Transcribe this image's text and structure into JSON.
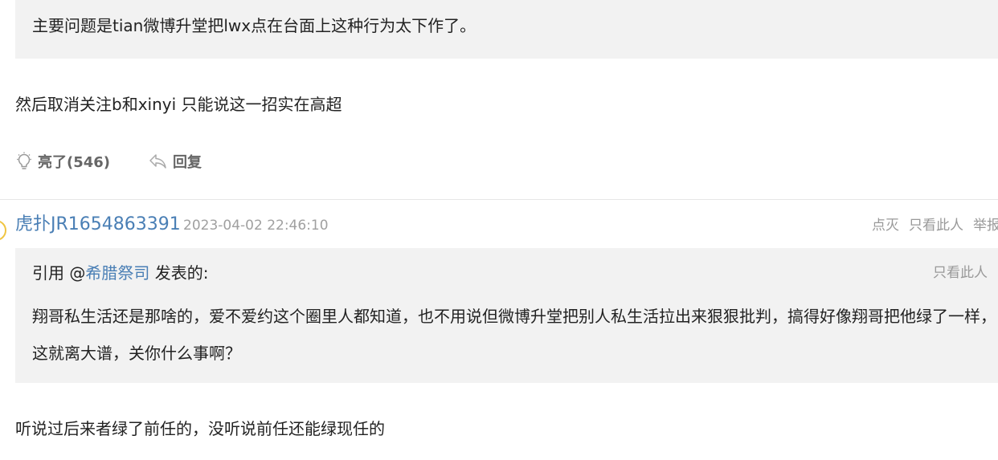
{
  "prev_post": {
    "quote_text": "主要问题是tian微博升堂把lwx点在台面上这种行为太下作了。",
    "body": "然后取消关注b和xinyi 只能说这一招实在高超",
    "like_label": "亮了(546)",
    "reply_label": "回复"
  },
  "post": {
    "username": "虎扑JR1654863391",
    "timestamp": "2023-04-02 22:46:10",
    "links": {
      "dim": "点灭",
      "only_this": "只看此人",
      "report": "举报"
    },
    "quote": {
      "prefix": "引用 @",
      "author": "希腊祭司",
      "suffix": " 发表的:",
      "only_this": "只看此人",
      "text": "翔哥私生活还是那啥的，爱不爱约这个圈里人都知道，也不用说但微博升堂把别人私生活拉出来狠狠批判，搞得好像翔哥把他绿了一样，这就离大谱，关你什么事啊？"
    },
    "body": "听说过后来者绿了前任的，没听说前任还能绿现任的"
  }
}
